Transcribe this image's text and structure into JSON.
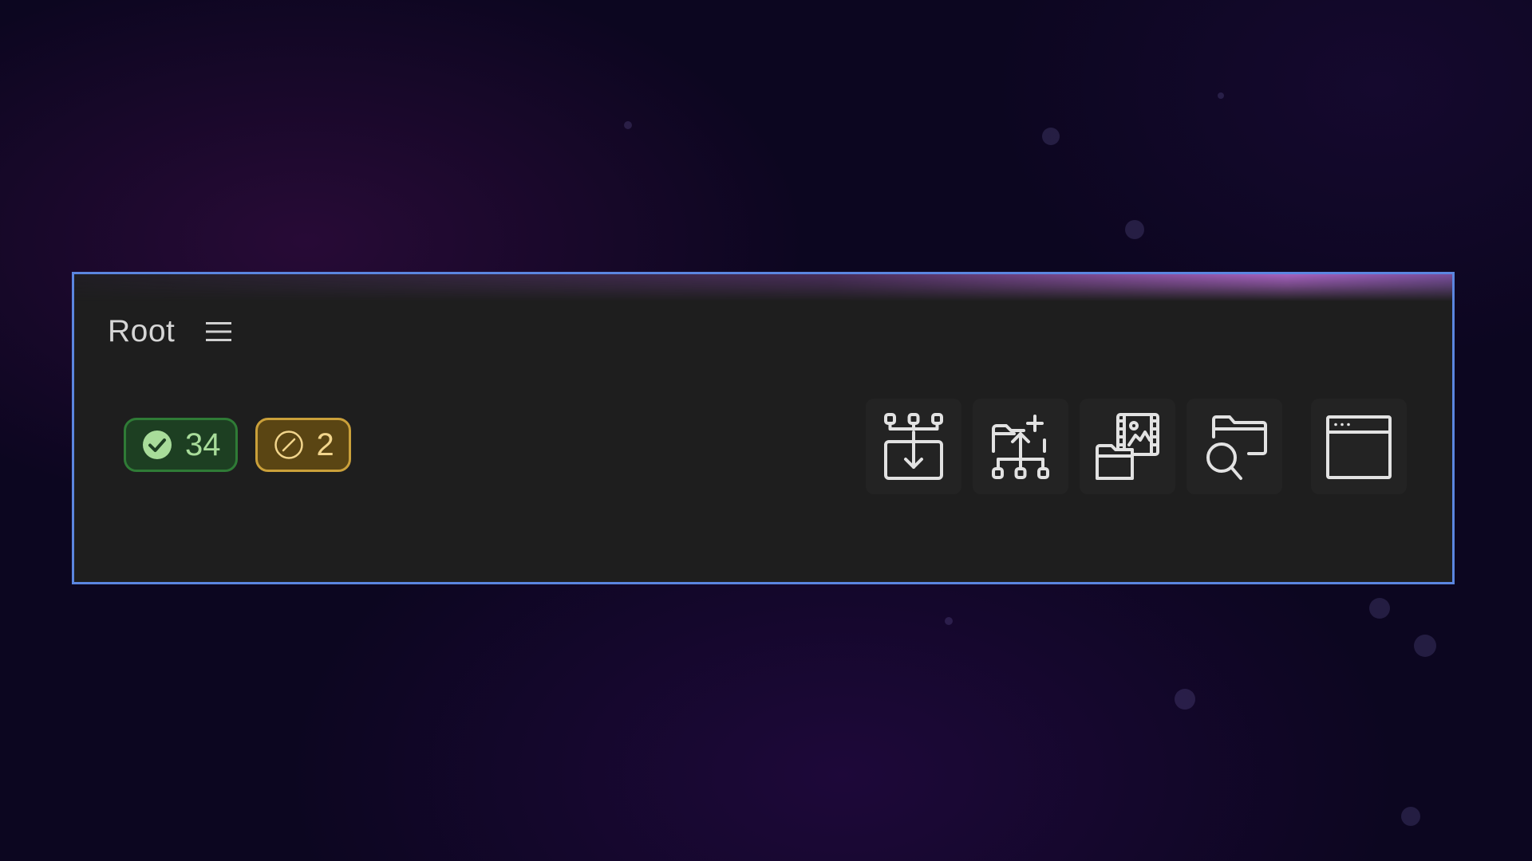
{
  "panel": {
    "title": "Root",
    "menu_icon": "hamburger-menu-icon"
  },
  "status": {
    "passed": {
      "count": "34",
      "icon": "check-circle-icon",
      "color": "#2f7b36"
    },
    "skipped": {
      "count": "2",
      "icon": "prohibited-circle-icon",
      "color": "#caa03a"
    }
  },
  "toolbar": {
    "buttons": [
      {
        "icon": "collapse-all-icon"
      },
      {
        "icon": "expand-all-icon"
      },
      {
        "icon": "folder-media-icon"
      },
      {
        "icon": "folder-search-icon"
      },
      {
        "icon": "browser-window-icon"
      }
    ]
  },
  "colors": {
    "panel_border": "#5b86e0",
    "panel_background": "#1e1e1e",
    "background": "#0c0620"
  }
}
